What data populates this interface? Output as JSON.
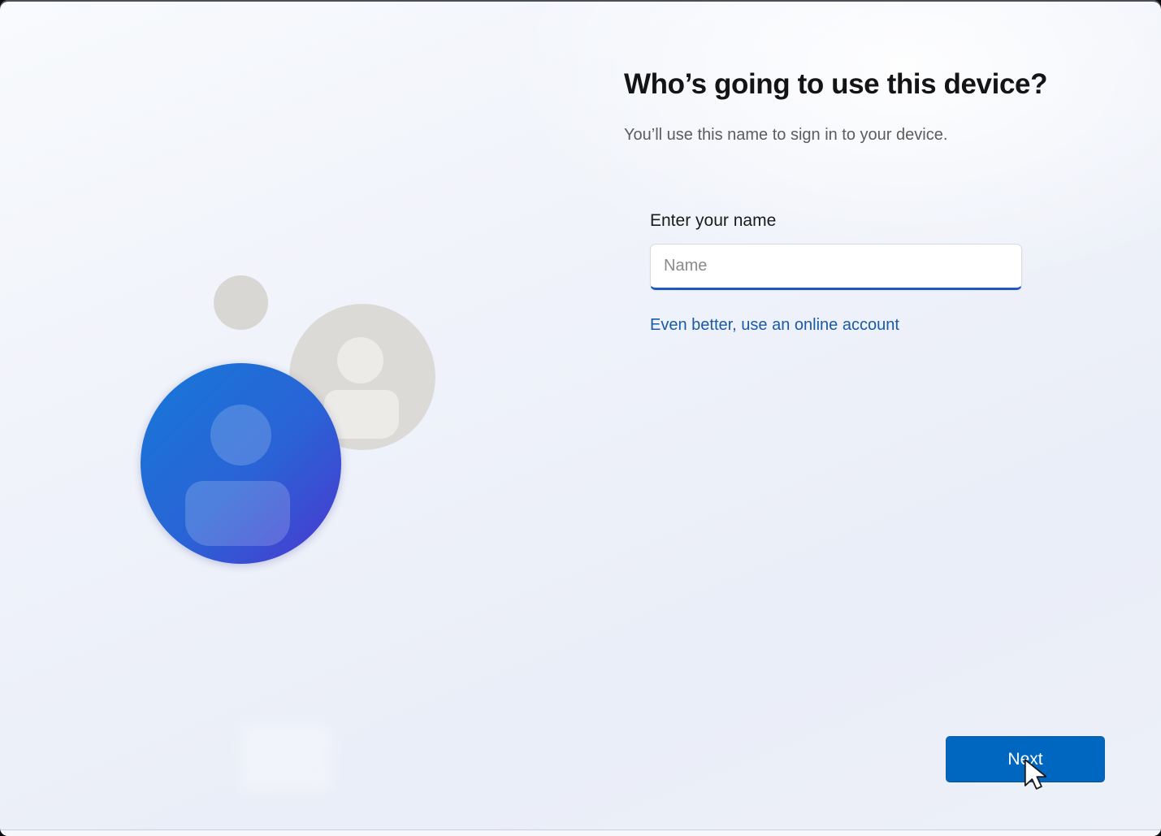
{
  "page": {
    "title": "Who’s going to use this device?",
    "subtitle": "You’ll use this name to sign in to your device."
  },
  "form": {
    "name_label": "Enter your name",
    "name_placeholder": "Name",
    "name_value": "",
    "online_account_link": "Even better, use an online account"
  },
  "actions": {
    "next_label": "Next"
  },
  "icons": {
    "avatar_primary": "person-icon",
    "avatar_secondary": "person-icon",
    "pointer": "arrow-cursor-icon"
  },
  "colors": {
    "accent": "#0067c0",
    "link": "#1a5aa6",
    "input_focus_underline": "#2057c0",
    "title_text": "#141414",
    "subtitle_text": "#5c5c5c",
    "avatar_gradient_start": "#1678d8",
    "avatar_gradient_end": "#4b37cf",
    "avatar_gray": "#dcdad6",
    "background_base": "#eef1f9"
  }
}
